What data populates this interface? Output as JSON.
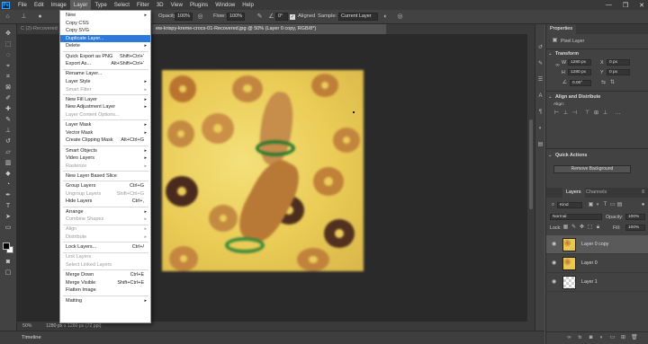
{
  "menubar": {
    "logo": "Ps",
    "items": [
      "File",
      "Edit",
      "Image",
      "Layer",
      "Type",
      "Select",
      "Filter",
      "3D",
      "View",
      "Plugins",
      "Window",
      "Help"
    ],
    "window_controls": [
      "—",
      "❐",
      "✕"
    ]
  },
  "options_bar": {
    "opacity_label": "Opacity:",
    "opacity_value": "100%",
    "flow_label": "Flow:",
    "flow_value": "100%",
    "angle_value": "0°",
    "aligned_label": "Aligned",
    "sample_label": "Sample:",
    "sample_value": "Current Layer"
  },
  "tabs": [
    {
      "label": "C (2)-Recovered",
      "active": false
    },
    {
      "label": "ew-krispy-kreme-crocs-01-Recovered.jpg @ 50% (Layer 0 copy, RGB/8*)",
      "active": true
    }
  ],
  "layer_menu": {
    "items": [
      {
        "label": "New",
        "shortcut": "",
        "submenu": true,
        "disabled": false
      },
      {
        "label": "Copy CSS",
        "shortcut": "",
        "submenu": false,
        "disabled": false
      },
      {
        "label": "Copy SVG",
        "shortcut": "",
        "submenu": false,
        "disabled": false
      },
      {
        "label": "Duplicate Layer...",
        "shortcut": "",
        "submenu": false,
        "disabled": false,
        "highlighted": true
      },
      {
        "label": "Delete",
        "shortcut": "",
        "submenu": true,
        "disabled": false
      },
      {
        "sep": true
      },
      {
        "label": "Quick Export as PNG",
        "shortcut": "Shift+Ctrl+'",
        "submenu": false,
        "disabled": false
      },
      {
        "label": "Export As...",
        "shortcut": "Alt+Shift+Ctrl+'",
        "submenu": false,
        "disabled": false
      },
      {
        "sep": true
      },
      {
        "label": "Rename Layer...",
        "shortcut": "",
        "submenu": false,
        "disabled": false
      },
      {
        "label": "Layer Style",
        "shortcut": "",
        "submenu": true,
        "disabled": false
      },
      {
        "label": "Smart Filter",
        "shortcut": "",
        "submenu": true,
        "disabled": true
      },
      {
        "sep": true
      },
      {
        "label": "New Fill Layer",
        "shortcut": "",
        "submenu": true,
        "disabled": false
      },
      {
        "label": "New Adjustment Layer",
        "shortcut": "",
        "submenu": true,
        "disabled": false
      },
      {
        "label": "Layer Content Options...",
        "shortcut": "",
        "submenu": false,
        "disabled": true
      },
      {
        "sep": true
      },
      {
        "label": "Layer Mask",
        "shortcut": "",
        "submenu": true,
        "disabled": false
      },
      {
        "label": "Vector Mask",
        "shortcut": "",
        "submenu": true,
        "disabled": false
      },
      {
        "label": "Create Clipping Mask",
        "shortcut": "Alt+Ctrl+G",
        "submenu": false,
        "disabled": false
      },
      {
        "sep": true
      },
      {
        "label": "Smart Objects",
        "shortcut": "",
        "submenu": true,
        "disabled": false
      },
      {
        "label": "Video Layers",
        "shortcut": "",
        "submenu": true,
        "disabled": false
      },
      {
        "label": "Rasterize",
        "shortcut": "",
        "submenu": true,
        "disabled": true
      },
      {
        "sep": true
      },
      {
        "label": "New Layer Based Slice",
        "shortcut": "",
        "submenu": false,
        "disabled": false
      },
      {
        "sep": true
      },
      {
        "label": "Group Layers",
        "shortcut": "Ctrl+G",
        "submenu": false,
        "disabled": false
      },
      {
        "label": "Ungroup Layers",
        "shortcut": "Shift+Ctrl+G",
        "submenu": false,
        "disabled": true
      },
      {
        "label": "Hide Layers",
        "shortcut": "Ctrl+,",
        "submenu": false,
        "disabled": false
      },
      {
        "sep": true
      },
      {
        "label": "Arrange",
        "shortcut": "",
        "submenu": true,
        "disabled": false
      },
      {
        "label": "Combine Shapes",
        "shortcut": "",
        "submenu": true,
        "disabled": true
      },
      {
        "sep": true
      },
      {
        "label": "Align",
        "shortcut": "",
        "submenu": true,
        "disabled": true
      },
      {
        "label": "Distribute",
        "shortcut": "",
        "submenu": true,
        "disabled": true
      },
      {
        "sep": true
      },
      {
        "label": "Lock Layers...",
        "shortcut": "Ctrl+/",
        "submenu": false,
        "disabled": false
      },
      {
        "sep": true
      },
      {
        "label": "Link Layers",
        "shortcut": "",
        "submenu": false,
        "disabled": true
      },
      {
        "label": "Select Linked Layers",
        "shortcut": "",
        "submenu": false,
        "disabled": true
      },
      {
        "sep": true
      },
      {
        "label": "Merge Down",
        "shortcut": "Ctrl+E",
        "submenu": false,
        "disabled": false
      },
      {
        "label": "Merge Visible",
        "shortcut": "Shift+Ctrl+E",
        "submenu": false,
        "disabled": false
      },
      {
        "label": "Flatten Image",
        "shortcut": "",
        "submenu": false,
        "disabled": false
      },
      {
        "sep": true
      },
      {
        "label": "Matting",
        "shortcut": "",
        "submenu": true,
        "disabled": false
      }
    ]
  },
  "status": {
    "zoom": "50%",
    "doc_info": "1280 px x 1280 px (72 ppi)"
  },
  "timeline_label": "Timeline",
  "properties": {
    "tab": "Properties",
    "kind": "Pixel Layer",
    "transform_title": "Transform",
    "w_label": "W",
    "w_value": "1280 px",
    "h_label": "H",
    "h_value": "1280 px",
    "x_label": "X",
    "x_value": "0 px",
    "y_label": "Y",
    "y_value": "0 px",
    "angle_value": "0.00°",
    "align_title": "Align and Distribute",
    "align_label": "Align:",
    "quick_actions_title": "Quick Actions",
    "remove_bg_button": "Remove Background"
  },
  "layers_panel": {
    "tabs": [
      "Layers",
      "Channels"
    ],
    "filter_kind": "Kind",
    "blend_mode": "Normal",
    "opacity_label": "Opacity:",
    "opacity_value": "100%",
    "lock_label": "Lock:",
    "fill_label": "Fill:",
    "fill_value": "100%",
    "layers": [
      {
        "name": "Layer 0 copy",
        "selected": true,
        "thumb": "image"
      },
      {
        "name": "Layer 0",
        "selected": false,
        "thumb": "image"
      },
      {
        "name": "Layer 1",
        "selected": false,
        "thumb": "transparent"
      }
    ],
    "footer_icons": [
      "link-icon",
      "fx-icon",
      "mask-icon",
      "adjustment-icon",
      "folder-icon",
      "new-layer-icon",
      "trash-icon"
    ]
  }
}
